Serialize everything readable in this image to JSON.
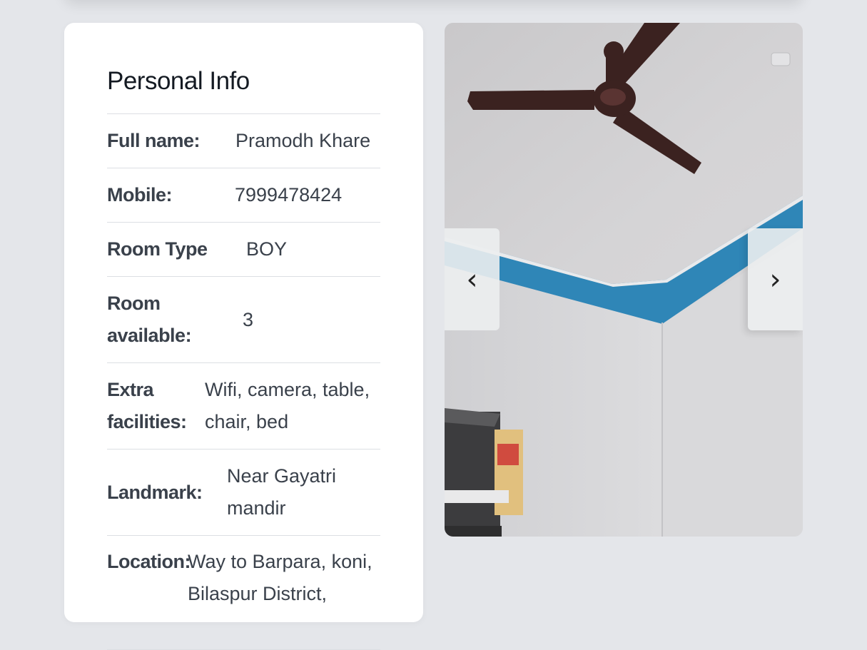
{
  "personal_info": {
    "title": "Personal Info",
    "rows": [
      {
        "label": "Full name:",
        "value": "Pramodh Khare"
      },
      {
        "label": "Mobile:",
        "value": "7999478424"
      },
      {
        "label": "Room Type",
        "value": "BOY"
      },
      {
        "label": "Room available:",
        "value": "3"
      },
      {
        "label": "Extra facilities:",
        "value": "Wifi, camera, table, chair, bed"
      },
      {
        "label": "Landmark:",
        "value": "Near Gayatri mandir"
      },
      {
        "label": "Location:",
        "value": "Way to Barpara, koni, Bilaspur District,"
      }
    ]
  },
  "gallery": {
    "prev_label": "‹",
    "next_label": "›",
    "colors": {
      "wall": "#d6d5d8",
      "trim": "#2f86b7",
      "fan": "#3b2220"
    }
  }
}
